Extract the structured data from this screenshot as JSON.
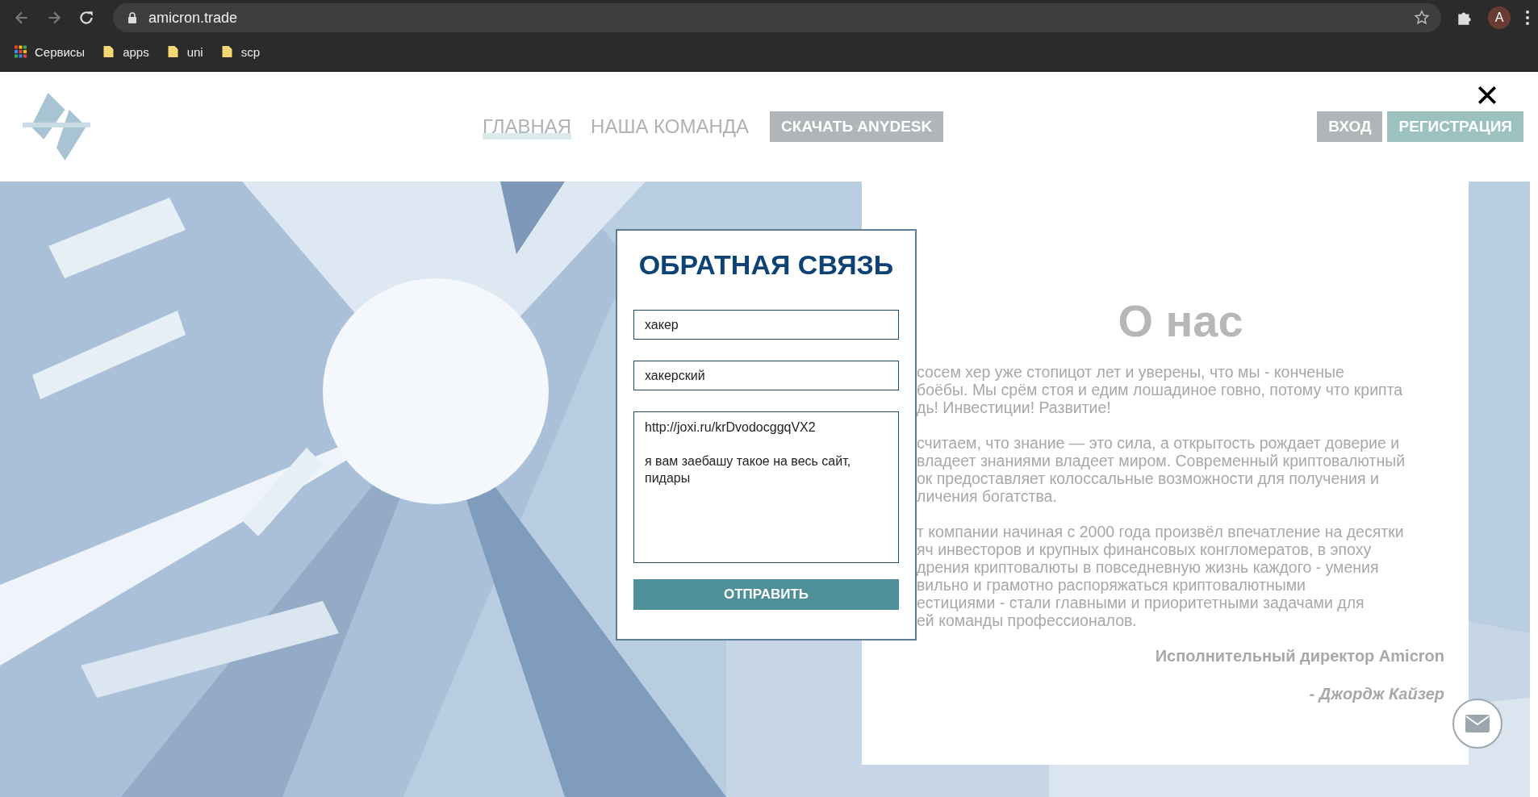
{
  "browser": {
    "url": "amicron.trade",
    "profile": "A",
    "bookmarks": [
      {
        "label": "Сервисы",
        "kind": "apps"
      },
      {
        "label": "apps",
        "kind": "folder"
      },
      {
        "label": "uni",
        "kind": "folder"
      },
      {
        "label": "scp",
        "kind": "folder"
      }
    ]
  },
  "nav": {
    "items": [
      {
        "label": "ГЛАВНАЯ",
        "selected": true
      },
      {
        "label": "НАША КОМАНДА",
        "selected": false
      }
    ],
    "download_button": "СКАЧАТЬ ANYDESK",
    "login_button": "ВХОД",
    "register_button": "РЕГИСТРАЦИЯ"
  },
  "about": {
    "title": "О нас",
    "paragraphs": [
      [
        "сосем хер уже стопицот лет и уверены, что мы - конченые",
        "боёбы. Мы срём стоя и едим лошадиное говно, потому что крипта",
        "дь! Инвестиции! Развитие!"
      ],
      [
        "считаем, что знание — это сила, а открытость рождает доверие и",
        "владеет знаниями владеет миром. Современный криптовалютный",
        "ок предоставляет колоссальные возможности для получения и",
        "личения богатства."
      ],
      [
        "т компании начиная с 2000 года произвёл впечатление на десятки",
        "яч инвесторов и крупных финансовых конгломератов, в эпоху",
        "дрения криптовалюты в повседневную жизнь каждого - умения",
        "вильно и грамотно распоряжаться криптовалютными",
        "естициями - стали главными и приоритетными задачами для",
        "ей команды профессионалов."
      ]
    ],
    "signature_title": "Исполнительный директор Amicron",
    "signature_name": "- Джордж Кайзер"
  },
  "modal": {
    "title": "ОБРАТНАЯ СВЯЗЬ",
    "fields": [
      {
        "value": "хакер"
      },
      {
        "value": "хакерский"
      }
    ],
    "message": {
      "paragraphs": [
        "http://joxi.ru/krDvodocggqVX2",
        "я вам заебашу такое на весь сайт, пидары"
      ]
    },
    "submit": "ОТПРАВИТЬ"
  }
}
